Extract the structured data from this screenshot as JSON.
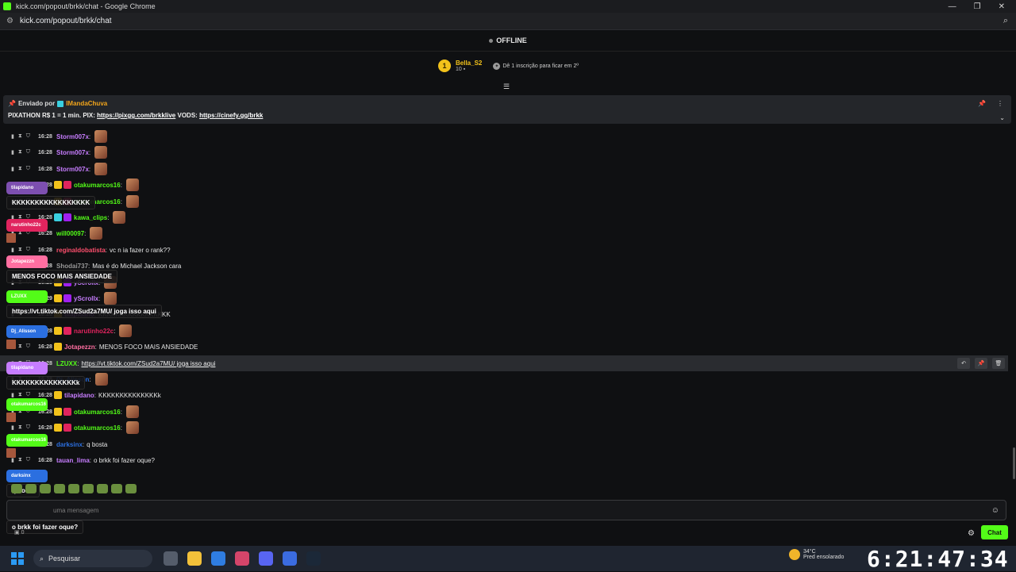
{
  "window": {
    "title": "kick.com/popout/brkk/chat - Google Chrome",
    "url": "kick.com/popout/brkk/chat",
    "accent": "#53fc18"
  },
  "status": {
    "label": "OFFLINE"
  },
  "leaderboard": {
    "rank": "1",
    "name": "Bella_S2",
    "count": "10",
    "cta": "Dê 1 inscrição para ficar em 2º"
  },
  "pinned": {
    "prefix": "Enviado por",
    "author": "IMandaChuva",
    "text_before": "PIXATHON R$ 1 = 1 min. PIX:",
    "link1": "https://pixgg.com/brkklive",
    "mid": "VODS:",
    "link2": "https://cinefy.gg/brkk"
  },
  "messages": [
    {
      "time": "16:28",
      "user": "Storm007x",
      "color": "#c77dff",
      "text": "",
      "emote": true,
      "badges": []
    },
    {
      "time": "16:28",
      "user": "Storm007x",
      "color": "#c77dff",
      "text": "",
      "emote": true,
      "badges": []
    },
    {
      "time": "16:28",
      "user": "Storm007x",
      "color": "#c77dff",
      "text": "",
      "emote": true,
      "badges": []
    },
    {
      "time": "16:28",
      "user": "otakumarcos16",
      "color": "#53fc18",
      "text": "",
      "emote": true,
      "badges": [
        "#f2c21b",
        "#e0245e"
      ]
    },
    {
      "time": "16:28",
      "user": "otakumarcos16",
      "color": "#53fc18",
      "text": "",
      "emote": true,
      "badges": [
        "#f2c21b",
        "#e0245e"
      ]
    },
    {
      "time": "16:28",
      "user": "kawa_clips",
      "color": "#53fc18",
      "text": "",
      "emote": true,
      "badges": [
        "#3ad0e0",
        "#a020f0"
      ]
    },
    {
      "time": "16:28",
      "user": "will00097",
      "color": "#53fc18",
      "text": "",
      "emote": true,
      "badges": []
    },
    {
      "time": "16:28",
      "user": "reginaldobatista",
      "color": "#ff4f6d",
      "text": "vc n ia fazer o rank??",
      "emote": false,
      "badges": []
    },
    {
      "time": "16:28",
      "user": "Shodai737",
      "color": "#999999",
      "text": "Mas é do Michael Jackson cara",
      "emote": false,
      "badges": []
    },
    {
      "time": "16:28",
      "user": "yScrollx",
      "color": "#c77dff",
      "text": "",
      "emote": true,
      "badges": [
        "#f2c21b",
        "#a020f0"
      ]
    },
    {
      "time": "16:29",
      "user": "yScrollx",
      "color": "#c77dff",
      "text": "",
      "emote": true,
      "badges": [
        "#f2c21b",
        "#a020f0"
      ]
    },
    {
      "time": "16:28",
      "user": "tilapidano",
      "color": "#c77dff",
      "text": "KKKKKKKKKKKKKKKKK",
      "emote": false,
      "badges": [
        "#f2c21b"
      ]
    },
    {
      "time": "16:28",
      "user": "narutinho22c",
      "color": "#e0245e",
      "text": "",
      "emote": true,
      "badges": [
        "#f2c21b",
        "#e0245e"
      ]
    },
    {
      "time": "16:28",
      "user": "Jotapezzn",
      "color": "#ff6fa1",
      "text": "MENOS FOCO MAIS ANSIEDADE",
      "emote": false,
      "badges": [
        "#f2c21b"
      ]
    },
    {
      "time": "16:28",
      "user": "LZUXX",
      "color": "#53fc18",
      "text": "https://vt.tiktok.com/ZSud2a7MU/ joga isso aqui",
      "emote": false,
      "badges": [],
      "hover": true
    },
    {
      "time": "16:28",
      "user": "Dj_Alisson",
      "color": "#2b6fe0",
      "text": "",
      "emote": true,
      "badges": []
    },
    {
      "time": "16:28",
      "user": "tilapidano",
      "color": "#c77dff",
      "text": "KKKKKKKKKKKKKKk",
      "emote": false,
      "badges": [
        "#f2c21b"
      ]
    },
    {
      "time": "16:28",
      "user": "otakumarcos16",
      "color": "#53fc18",
      "text": "",
      "emote": true,
      "badges": [
        "#f2c21b",
        "#e0245e"
      ]
    },
    {
      "time": "16:28",
      "user": "otakumarcos16",
      "color": "#53fc18",
      "text": "",
      "emote": true,
      "badges": [
        "#f2c21b",
        "#e0245e"
      ]
    },
    {
      "time": "16:28",
      "user": "darksinx",
      "color": "#2b6fe0",
      "text": "q bosta",
      "emote": false,
      "badges": []
    },
    {
      "time": "16:28",
      "user": "tauan_lima",
      "color": "#c77dff",
      "text": "o brkk foi fazer oque?",
      "emote": false,
      "badges": []
    }
  ],
  "overlays": [
    {
      "tag": "tilapidano",
      "color": "#7d4fb0",
      "body": "KKKKKKKKKKKKKKKKK"
    },
    {
      "tag": "narutinho22c",
      "color": "#e0245e",
      "body": ""
    },
    {
      "tag": "Jotapezzn",
      "color": "#ff6fa1",
      "body": "MENOS FOCO MAIS ANSIEDADE"
    },
    {
      "tag": "LZUXX",
      "color": "#53fc18",
      "body": "https://vt.tiktok.com/ZSud2a7MU/ joga isso aqui"
    },
    {
      "tag": "Dj_Alisson",
      "color": "#2b6fe0",
      "body": ""
    },
    {
      "tag": "tilapidano",
      "color": "#c77dff",
      "body": "KKKKKKKKKKKKKKk"
    },
    {
      "tag": "otakumarcos16",
      "color": "#53fc18",
      "body": ""
    },
    {
      "tag": "otakumarcos16",
      "color": "#53fc18",
      "body": ""
    },
    {
      "tag": "darksinx",
      "color": "#2b6fe0",
      "body": "q bosta"
    },
    {
      "tag": "tauan_lima",
      "color": "#c77dff",
      "body": "o brkk foi fazer oque?"
    }
  ],
  "input": {
    "placeholder": "uma mensagem",
    "send_label": "Chat",
    "points": "0"
  },
  "taskbar": {
    "search": "Pesquisar",
    "temp": "34°C",
    "weather": "Pred ensolarado",
    "clock": "6:21:47:34"
  }
}
